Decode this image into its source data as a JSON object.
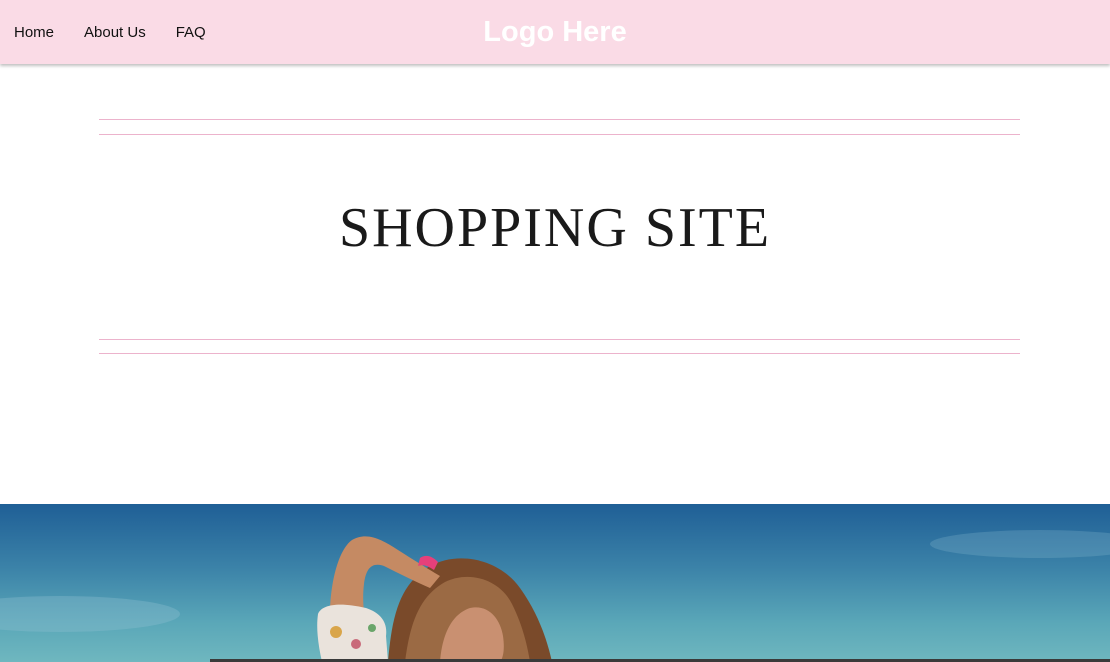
{
  "nav": {
    "links": [
      "Home",
      "About Us",
      "FAQ"
    ]
  },
  "logo": {
    "text": "Logo Here"
  },
  "hero": {
    "title": "SHOPPING SITE"
  },
  "colors": {
    "navbar_bg": "#fadbe6",
    "rule": "#ecb3cc",
    "title": "#1a1a1a",
    "logo": "#ffffff"
  }
}
